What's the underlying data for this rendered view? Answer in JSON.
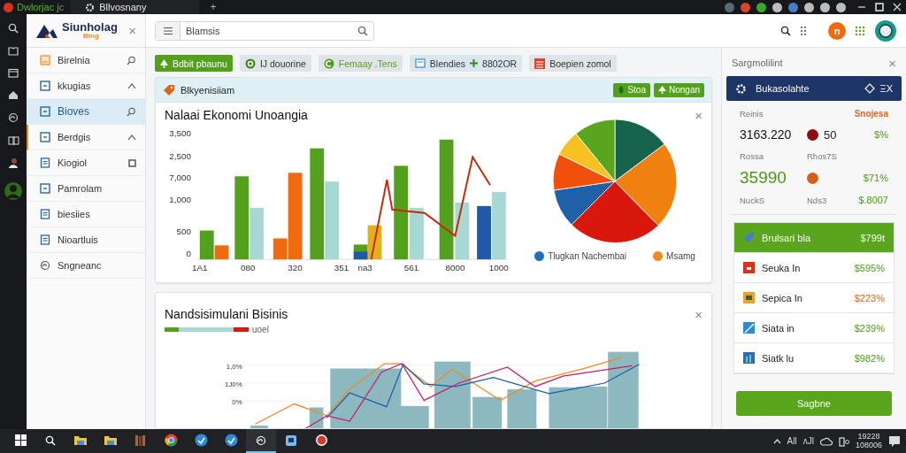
{
  "title_bar": {
    "app_label": "Dwlorjac jc",
    "tab_label": "Bllvosnany",
    "new_tab": "+"
  },
  "rail": {
    "items": [
      {
        "kind": "search"
      },
      {
        "kind": "book"
      },
      {
        "kind": "calendar"
      },
      {
        "kind": "home"
      },
      {
        "kind": "swirl"
      },
      {
        "kind": "cards"
      },
      {
        "kind": "person"
      },
      {
        "kind": "avatar"
      }
    ]
  },
  "sidebar": {
    "logo": "Siunholag",
    "logo_sub": "Bing",
    "close": "×",
    "items": [
      {
        "label": "Birelnia",
        "selected": false,
        "accent": false
      },
      {
        "label": "kkugias",
        "selected": false,
        "accent": false
      },
      {
        "label": "Bioves",
        "selected": true,
        "accent": false
      },
      {
        "label": "Berdgis",
        "selected": false,
        "accent": true
      },
      {
        "label": "Kiogiol",
        "selected": false,
        "accent": false
      },
      {
        "label": "Pamrolam",
        "selected": false,
        "accent": false
      },
      {
        "label": "biesiies",
        "selected": false,
        "accent": false
      },
      {
        "label": "Nioartluis",
        "selected": false,
        "accent": false
      },
      {
        "label": "Sngneanc",
        "selected": false,
        "accent": false
      }
    ]
  },
  "top_bar": {
    "search_value": "Blamsis",
    "avatar_letter": "n"
  },
  "filters": [
    {
      "label": "Bdbit pbaunu",
      "kind": "primary"
    },
    {
      "label": "IJ douorine",
      "kind": "plain"
    },
    {
      "label": "Femaay .Tens",
      "kind": "green-text"
    },
    {
      "label": "Blendies",
      "kind": "info",
      "extra": "8802OR"
    },
    {
      "label": "Boepien zomol",
      "kind": "plain"
    }
  ],
  "card_1": {
    "header": "Blkyenisiiam",
    "buttons": [
      "Stoa",
      "Nongan"
    ],
    "title": "Nalaai Ekonomi Unoangia",
    "close": "×",
    "y_labels": [
      "3,500",
      "2,500",
      "7,000",
      "1,000",
      "500",
      "0"
    ],
    "x_labels": [
      "1A1",
      "080",
      "320",
      "351",
      "na3",
      "561",
      "8000",
      "1000"
    ],
    "legend": [
      {
        "label": "Tlugkan Nachembai",
        "color": "#1f6fb8"
      },
      {
        "label": "Msamg",
        "color": "#f08a24"
      }
    ]
  },
  "card_2": {
    "title": "Nandsisimulani Bisinis",
    "close": "×",
    "legend_label": "uoel",
    "y_labels": [
      "1,0%",
      "1J0%",
      "0%"
    ]
  },
  "right_panel": {
    "title": "Sargmolilint",
    "close": "×",
    "banner": "Bukasolahte",
    "banner_action": "ΞX",
    "label_1": "Reinis",
    "label_1_value": "Snojesa",
    "stats": [
      {
        "value": "3163.220",
        "color": "#8b1010",
        "count": "50",
        "percent": "$%"
      },
      {
        "value": "35990",
        "color": "#d0621a",
        "percent": "$71%"
      }
    ],
    "sub_1": "Rossa",
    "sub_2": "Rhos7S",
    "sub_3": "NuckS",
    "sub_4": "Nds3",
    "pct_3": "$.8007",
    "list": [
      {
        "label": "Brulsari bla",
        "value": "$799t",
        "selected": true,
        "kind": "positive"
      },
      {
        "label": "Seuka In",
        "value": "$595%",
        "selected": false,
        "kind": "positive"
      },
      {
        "label": "Sepica In",
        "value": "$223%",
        "selected": false,
        "kind": "negative"
      },
      {
        "label": "Siata in",
        "value": "$239%",
        "selected": false,
        "kind": "positive"
      },
      {
        "label": "Siatk lu",
        "value": "$982%",
        "selected": false,
        "kind": "positive"
      }
    ],
    "button": "Sagbne"
  },
  "taskbar": {
    "apps": [
      {
        "kind": "windows",
        "selected": false
      },
      {
        "kind": "search",
        "selected": false
      },
      {
        "kind": "folder",
        "selected": false
      },
      {
        "kind": "folder",
        "selected": false
      },
      {
        "kind": "book",
        "selected": false
      },
      {
        "kind": "browser",
        "selected": false
      },
      {
        "kind": "blue",
        "selected": false
      },
      {
        "kind": "blue",
        "selected": false
      },
      {
        "kind": "swirl",
        "selected": true
      },
      {
        "kind": "note",
        "selected": false
      },
      {
        "kind": "red",
        "selected": false
      }
    ],
    "tray": [
      "All",
      "ᴧJl"
    ],
    "time": "19228",
    "date": "108006"
  }
}
